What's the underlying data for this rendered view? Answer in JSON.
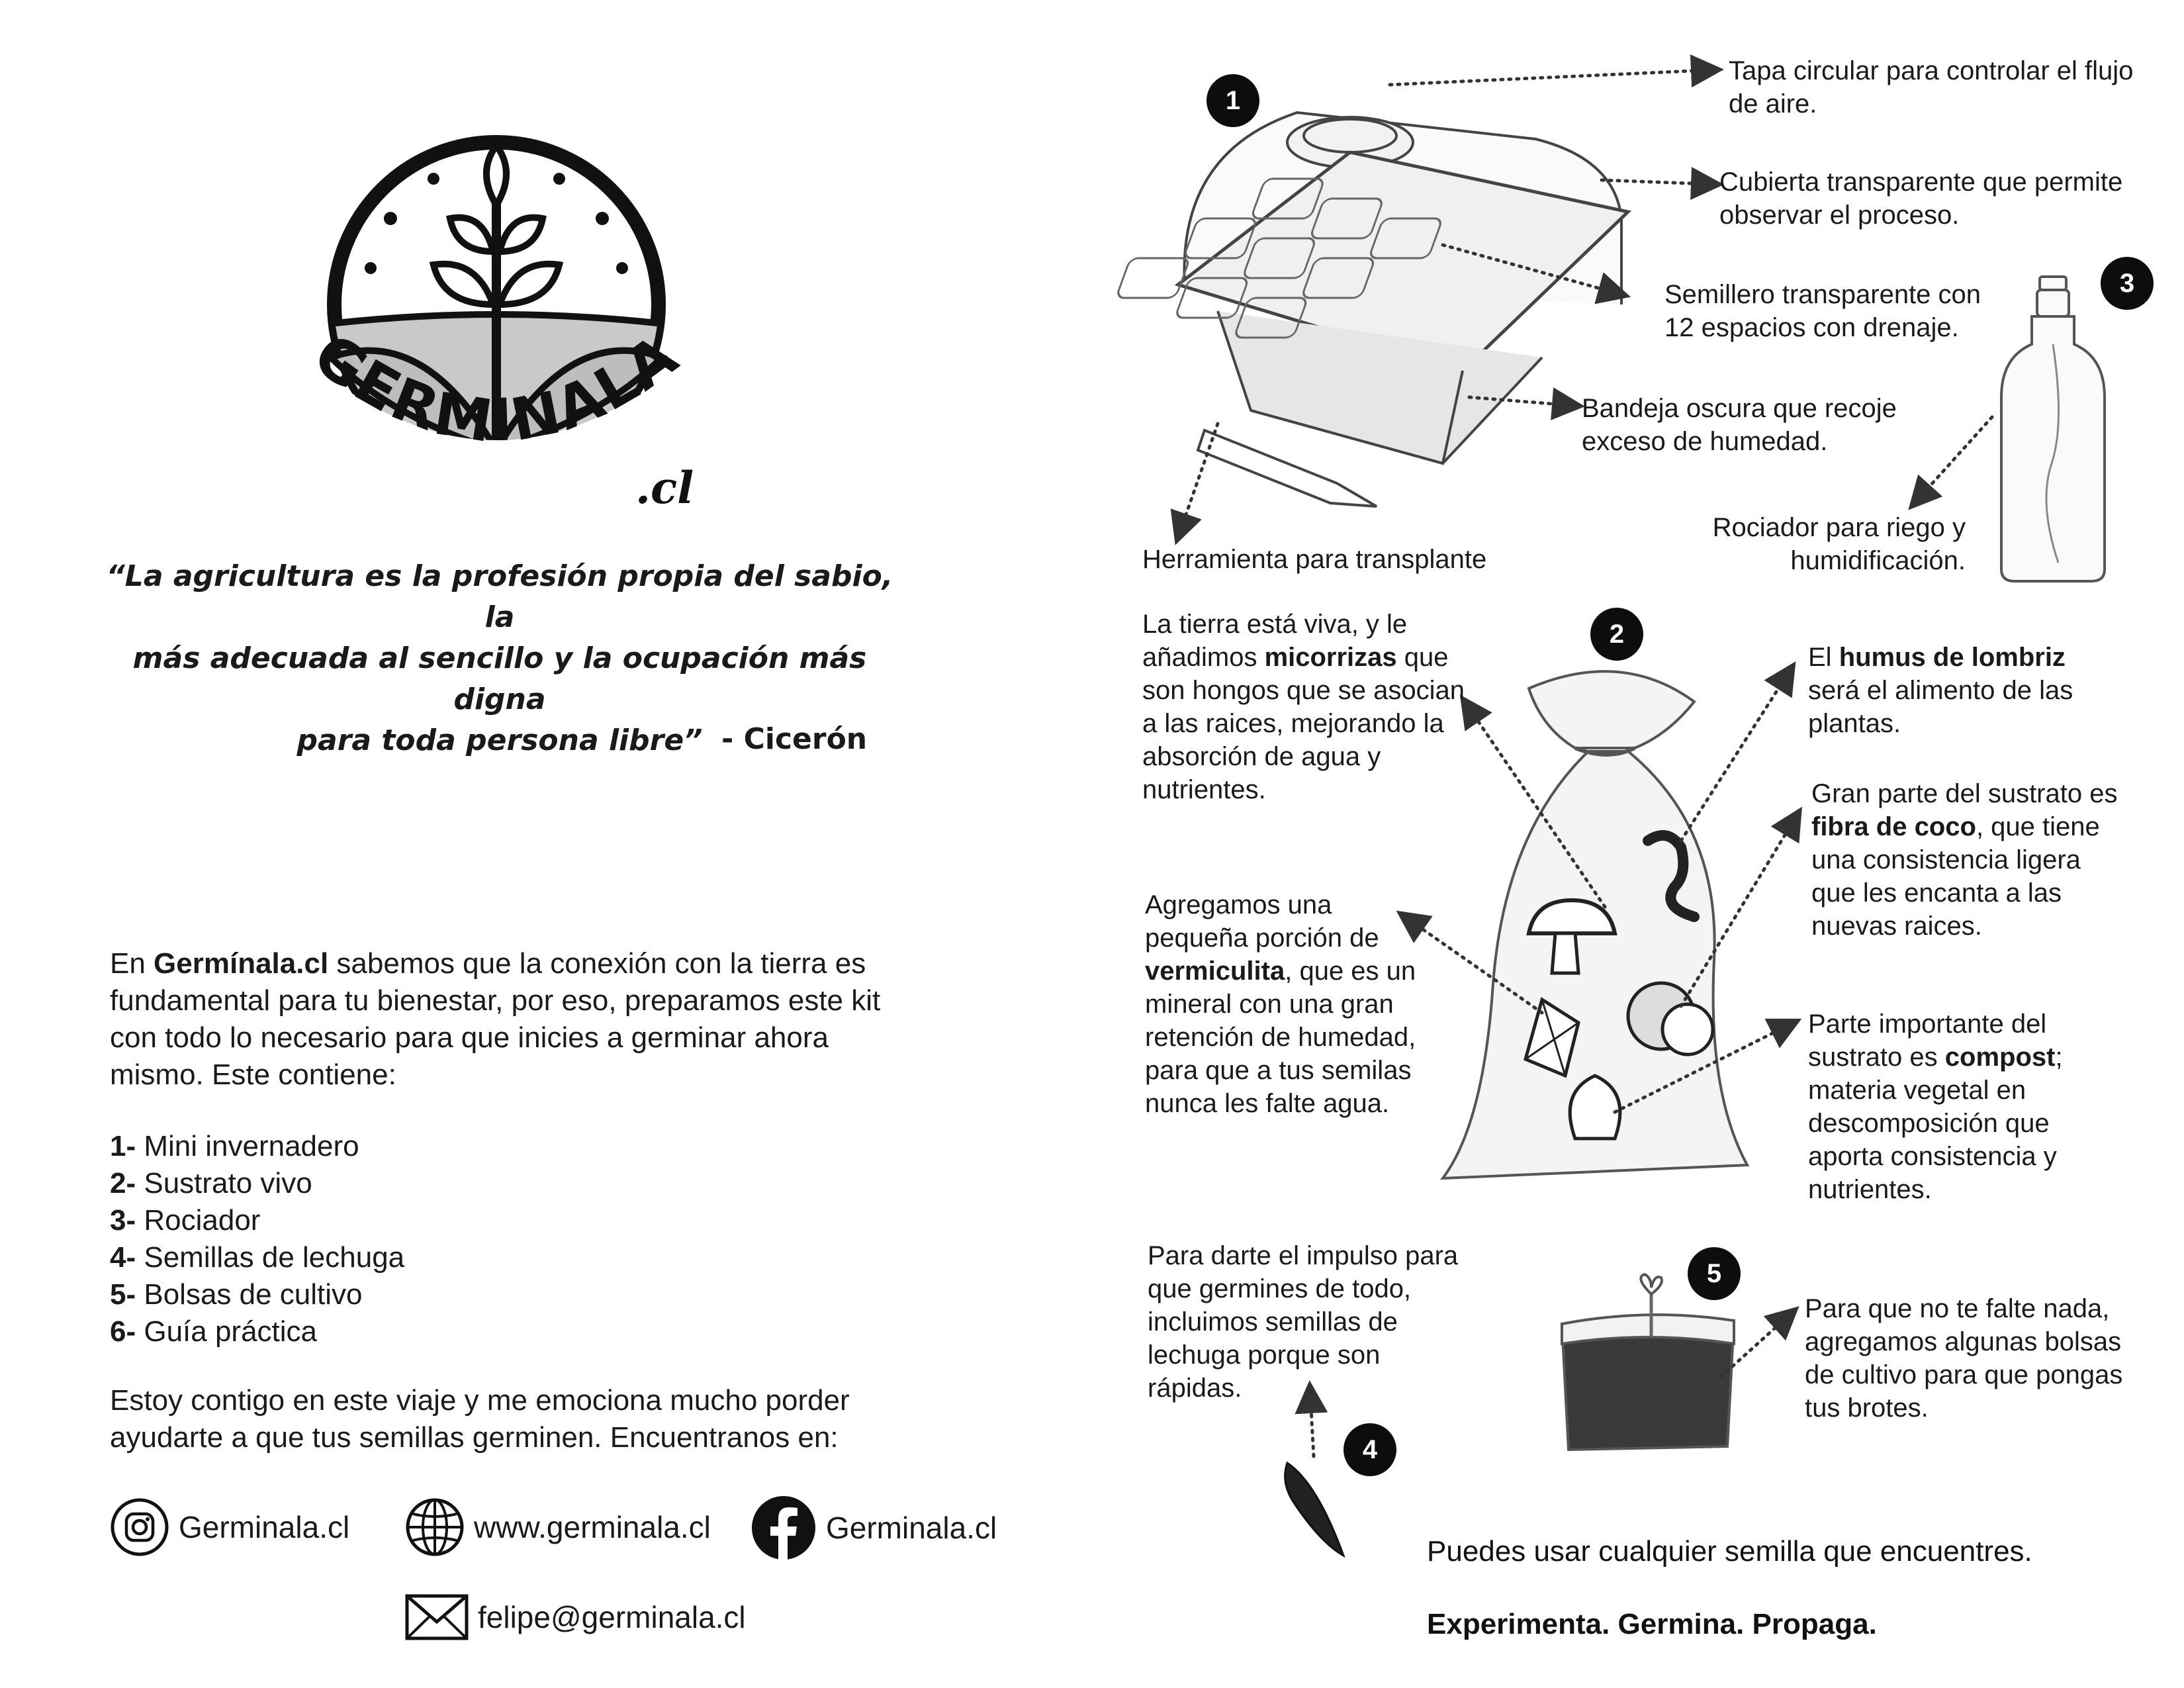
{
  "logo": {
    "brand": "GERMINALA",
    "suffix": ".cl"
  },
  "quote": {
    "line1": "“La agricultura es la profesión propia del sabio, la",
    "line2": "más adecuada al sencillo y la ocupación más digna",
    "line3": "para toda persona libre”",
    "author": "- Cicerón"
  },
  "intro": {
    "pre": "En ",
    "brand": "Germínala.cl",
    "rest1": " sabemos que la conexión con la tierra es",
    "line2": "fundamental para tu bienestar, por eso, preparamos este kit",
    "line3": "con todo lo necesario para que inicies a germinar ahora",
    "line4": "mismo. Este contiene:"
  },
  "contents": [
    {
      "num": "1-",
      "label": " Mini invernadero"
    },
    {
      "num": "2-",
      "label": " Sustrato vivo"
    },
    {
      "num": "3-",
      "label": " Rociador"
    },
    {
      "num": "4-",
      "label": " Semillas de lechuga"
    },
    {
      "num": "5-",
      "label": " Bolsas de cultivo"
    },
    {
      "num": "6-",
      "label": " Guía práctica"
    }
  ],
  "closing": {
    "line1": "Estoy contigo en este viaje y me emociona mucho porder",
    "line2": "ayudarte a que tus semillas germinen. Encuentranos en:"
  },
  "social": {
    "instagram": "Germinala.cl",
    "website": "www.germinala.cl",
    "facebook": "Germinala.cl",
    "email": "felipe@germinala.cl"
  },
  "badges": [
    "1",
    "2",
    "3",
    "4",
    "5"
  ],
  "greenhouse": {
    "lid_l1": "Tapa circular para controlar el flujo",
    "lid_l2": "de aire.",
    "cover_l1": "Cubierta transparente que permite",
    "cover_l2": "observar el proceso.",
    "tray_l1": "Semillero transparente con",
    "tray_l2": "12 espacios con drenaje.",
    "dark_l1": "Bandeja oscura que recoje",
    "dark_l2": "exceso de humedad.",
    "tool": "Herramienta para transplante"
  },
  "sprayer": {
    "l1": "Rociador para riego y",
    "l2": "humidificación."
  },
  "substrate": {
    "myco": {
      "l1": "La tierra está viva, y le",
      "l2_pre": "añadimos ",
      "l2_bold": "micorrizas",
      "l2_post": " que",
      "l3": "son hongos que se asocian",
      "l4": "a las raices, mejorando la",
      "l5": "absorción de agua y",
      "l6": "nutrientes."
    },
    "humus": {
      "l1_pre": "El ",
      "l1_bold": "humus de lombriz",
      "l2": "será el alimento de las",
      "l3": "plantas."
    },
    "coco": {
      "l1": "Gran parte del sustrato es",
      "l2_bold": "fibra de coco",
      "l2_post": ", que tiene",
      "l3": "una consistencia ligera",
      "l4": "que les encanta a las",
      "l5": "nuevas raices."
    },
    "vermi": {
      "l1": "Agregamos una",
      "l2": "pequeña porción de",
      "l3_bold": "vermiculita",
      "l3_post": ", que es un",
      "l4": "mineral con una gran",
      "l5": "retención de humedad,",
      "l6": "para que a tus semilas",
      "l7": "nunca les falte agua."
    },
    "compost": {
      "l1": "Parte importante del",
      "l2_pre": "sustrato es ",
      "l2_bold": "compost",
      "l2_post": ";",
      "l3": "materia vegetal en",
      "l4": "descomposición que",
      "l5": "aporta consistencia  y",
      "l6": "nutrientes."
    }
  },
  "seeds": {
    "l1": "Para darte el impulso para",
    "l2": "que germines de todo,",
    "l3": "incluimos semillas de",
    "l4": "lechuga porque son",
    "l5": "rápidas."
  },
  "bags": {
    "l1": "Para que no te falte nada,",
    "l2": "agregamos algunas bolsas",
    "l3": "de cultivo para que pongas",
    "l4": "tus brotes."
  },
  "footer": {
    "line1": "Puedes usar cualquier semilla que encuentres.",
    "line2": "Experimenta. Germina. Propaga."
  }
}
